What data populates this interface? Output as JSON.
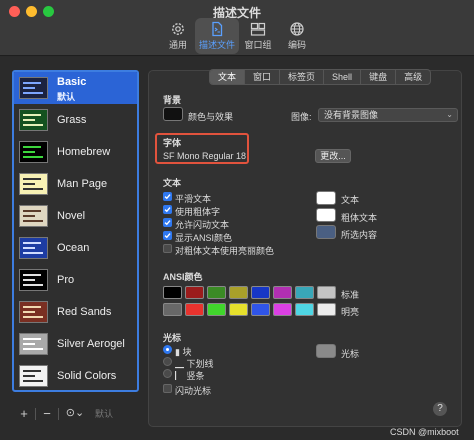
{
  "window": {
    "title": "描述文件"
  },
  "toolbar": {
    "items": [
      {
        "label": "通用",
        "icon": "gear-icon"
      },
      {
        "label": "描述文件",
        "icon": "document-icon"
      },
      {
        "label": "窗口组",
        "icon": "window-group-icon"
      },
      {
        "label": "编码",
        "icon": "globe-icon"
      }
    ],
    "active_index": 1
  },
  "profiles": {
    "items": [
      {
        "name": "Basic",
        "subtitle": "默认",
        "bg": "#1b2240",
        "fg": "#7da6ff"
      },
      {
        "name": "Grass",
        "bg": "#14521f",
        "fg": "#e6f0b8"
      },
      {
        "name": "Homebrew",
        "bg": "#000000",
        "fg": "#3dd63d"
      },
      {
        "name": "Man Page",
        "bg": "#f7f1b5",
        "fg": "#333333"
      },
      {
        "name": "Novel",
        "bg": "#dfd7c1",
        "fg": "#5a3b2a"
      },
      {
        "name": "Ocean",
        "bg": "#1d3ca3",
        "fg": "#d0dcff"
      },
      {
        "name": "Pro",
        "bg": "#000000",
        "fg": "#e0e0e0"
      },
      {
        "name": "Red Sands",
        "bg": "#7a2f22",
        "fg": "#f0d8b0"
      },
      {
        "name": "Silver Aerogel",
        "bg": "#a9a9a9",
        "fg": "#ffffff"
      },
      {
        "name": "Solid Colors",
        "bg": "#f2f2f2",
        "fg": "#333333"
      }
    ],
    "selected_index": 0
  },
  "bottom_bar": {
    "add": "+",
    "remove": "−",
    "more": "⊙⌄",
    "default": "默认"
  },
  "tabs": [
    "文本",
    "窗口",
    "标签页",
    "Shell",
    "键盘",
    "高级"
  ],
  "active_tab": 0,
  "background": {
    "heading": "背景",
    "color_effect": "颜色与效果",
    "image_label": "图像:",
    "image_value": "没有背景图像"
  },
  "font": {
    "heading": "字体",
    "value": "SF Mono Regular 18",
    "change_button": "更改..."
  },
  "text": {
    "heading": "文本",
    "options": [
      {
        "label": "平滑文本",
        "checked": true
      },
      {
        "label": "使用粗体字",
        "checked": true
      },
      {
        "label": "允许闪动文本",
        "checked": true
      },
      {
        "label": "显示ANSI颜色",
        "checked": true
      },
      {
        "label": "对粗体文本使用亮丽颜色",
        "checked": false
      }
    ],
    "colors": [
      {
        "label": "文本",
        "color": "#ffffff"
      },
      {
        "label": "粗体文本",
        "color": "#ffffff"
      },
      {
        "label": "所选内容",
        "color": "#4a5f82"
      }
    ]
  },
  "ansi": {
    "heading": "ANSI颜色",
    "normal_label": "标准",
    "bright_label": "明亮",
    "normal": [
      "#000000",
      "#9b1c1c",
      "#3b8b25",
      "#a9a02a",
      "#1737c6",
      "#b12fb2",
      "#38a7b8",
      "#c4c4c4"
    ],
    "bright": [
      "#686868",
      "#e8332e",
      "#41d62c",
      "#e6e02c",
      "#3055e8",
      "#db40e4",
      "#4fd6e4",
      "#ececec"
    ]
  },
  "cursor": {
    "heading": "光标",
    "options": [
      {
        "label": "▮ 块",
        "selected": true
      },
      {
        "label": "▁ 下划线",
        "selected": false
      },
      {
        "label": "▏ 竖条",
        "selected": false
      }
    ],
    "blink_label": "闪动光标",
    "blink_checked": false,
    "color_label": "光标",
    "color": "#8a8a8a"
  },
  "help": "?",
  "watermark": "CSDN @mixboot"
}
